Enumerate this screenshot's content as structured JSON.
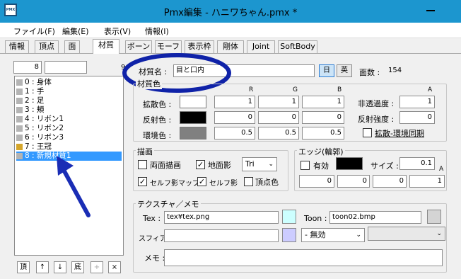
{
  "window": {
    "title": "Pmx編集 - ハニワちゃん.pmx *",
    "icon": "PMX"
  },
  "menu": [
    "ファイル(F)",
    "編集(E)",
    "表示(V)",
    "情報(I)"
  ],
  "tabs": [
    "情報",
    "頂点",
    "面",
    "材質",
    "ボーン",
    "モーフ",
    "表示枠",
    "剛体",
    "Joint",
    "SoftBody"
  ],
  "list": {
    "index": "8",
    "search": "",
    "extra": "9",
    "items": [
      {
        "label": "0 : 身体",
        "color": "#b4b4b4"
      },
      {
        "label": "1 : 手",
        "color": "#b4b4b4"
      },
      {
        "label": "2 : 足",
        "color": "#b4b4b4"
      },
      {
        "label": "3 : 頬",
        "color": "#b4b4b4"
      },
      {
        "label": "4 : リボン1",
        "color": "#b4b4b4"
      },
      {
        "label": "5 : リボン2",
        "color": "#b4b4b4"
      },
      {
        "label": "6 : リボン3",
        "color": "#b4b4b4"
      },
      {
        "label": "7 : 王冠",
        "color": "#d4a52a"
      },
      {
        "label": "8 : 新規材質1",
        "color": "#b4b4b4"
      }
    ],
    "buttons": [
      "頂",
      "↑",
      "↓",
      "底",
      "+",
      "×"
    ]
  },
  "material": {
    "name_label": "材質名 :",
    "name_value": "目と口内",
    "lang_jp": "日",
    "lang_en": "英",
    "face_label": "面数 :",
    "face_count": "154"
  },
  "color": {
    "group": "材質色",
    "r": "R",
    "g": "G",
    "b": "B",
    "a": "A",
    "diffuse_label": "拡散色 :",
    "diffuse": [
      "1",
      "1",
      "1"
    ],
    "diffuse_swatch": "#ffffff",
    "specular_label": "反射色 :",
    "specular": [
      "0",
      "0",
      "0"
    ],
    "specular_swatch": "#000000",
    "ambient_label": "環境色 :",
    "ambient": [
      "0.5",
      "0.5",
      "0.5"
    ],
    "ambient_swatch": "#808080",
    "alpha_label": "非透過度 :",
    "alpha": "1",
    "spec_power_label": "反射強度 :",
    "spec_power": "0",
    "sync_label": "拡散-環境同期"
  },
  "draw": {
    "group": "描画",
    "double_sided": "両面描画",
    "ground_shadow": "地面影",
    "shadow_mode": "Tri",
    "self_shadow_map": "セルフ影マップ",
    "self_shadow": "セルフ影",
    "vertex_color": "頂点色"
  },
  "edge": {
    "group": "エッジ(輪郭)",
    "enabled_label": "有効",
    "size_label": "サイズ :",
    "size": "0.1",
    "a": "A",
    "values": [
      "0",
      "0",
      "0",
      "1"
    ],
    "swatch": "#000000"
  },
  "texture": {
    "group": "テクスチャ／メモ",
    "tex_label": "Tex :",
    "tex_value": "tex¥tex.png",
    "toon_label": "Toon :",
    "toon_value": "toon02.bmp",
    "sphere_label": "スフィア:",
    "sphere_value": "",
    "sphere_mode": "- 無効",
    "memo_label": "メモ :",
    "memo_value": "",
    "tex_swatch": "#ccffff",
    "sphere_swatch": "#ccccff",
    "toon_swatch": "#d4d4d4"
  },
  "annotation": {
    "ellipse_color": "#0f22a8",
    "arrow_color": "#1a2db5"
  }
}
